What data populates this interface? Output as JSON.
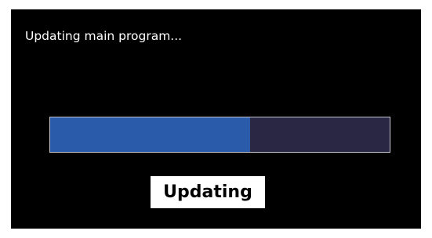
{
  "screen": {
    "message": "Updating main program...",
    "status_label": "Updating"
  },
  "progress": {
    "value": 0.59
  },
  "colors": {
    "background": "#000000",
    "text": "#ffffff",
    "progress_fill": "#2a5baa",
    "progress_track": "#2a2745",
    "progress_border": "#c8c8d0"
  }
}
